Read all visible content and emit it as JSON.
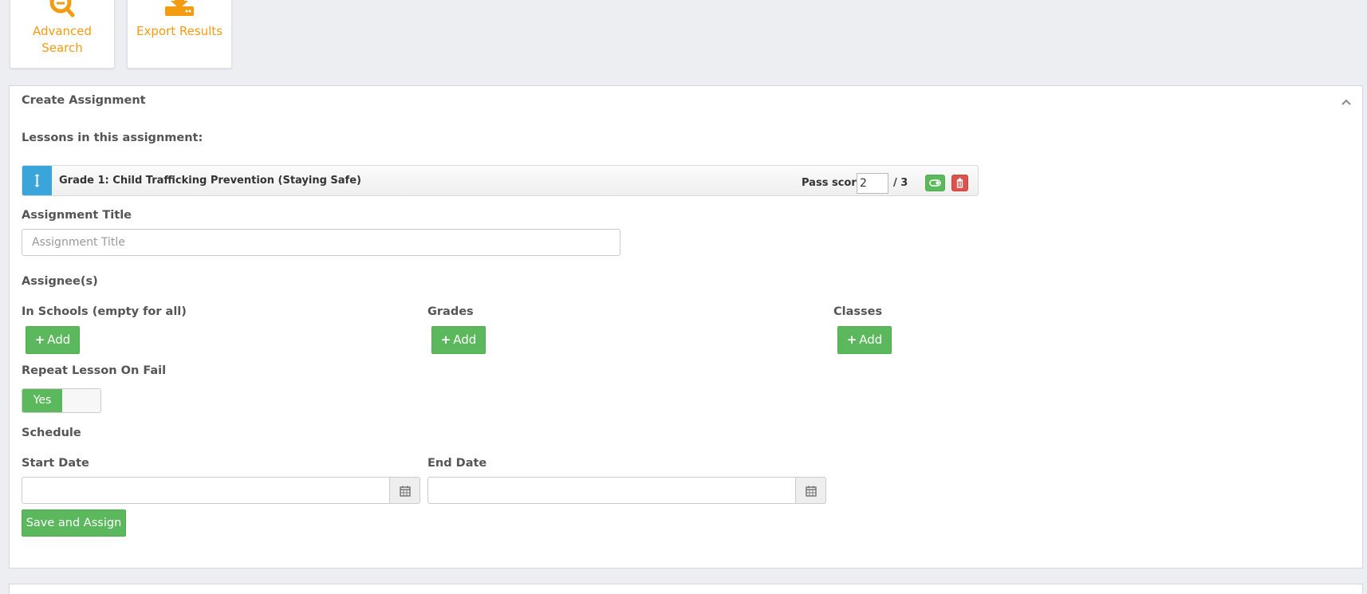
{
  "toolbar": {
    "advanced_search": "Advanced Search",
    "export_results": "Export Results"
  },
  "create_assignment": {
    "title": "Create Assignment",
    "lessons_label": "Lessons in this assignment:",
    "lessons": [
      {
        "name": "Grade 1: Child Trafficking Prevention (Staying Safe)",
        "pass_score_label": "Pass score",
        "pass_score": "2",
        "total": "/ 3"
      }
    ],
    "assignment_title_label": "Assignment Title",
    "assignment_title_placeholder": "Assignment Title",
    "assignment_title_value": "",
    "assignees_label": "Assignee(s)",
    "schools_label": "In Schools (empty for all)",
    "grades_label": "Grades",
    "classes_label": "Classes",
    "add_label": "Add",
    "repeat_label": "Repeat Lesson On Fail",
    "repeat_value": "Yes",
    "schedule_label": "Schedule",
    "start_date_label": "Start Date",
    "end_date_label": "End Date",
    "start_date_value": "",
    "end_date_value": "",
    "save_label": "Save and Assign"
  },
  "colors": {
    "accent_orange": "#f39c12",
    "success_green": "#5cb85c",
    "danger_red": "#d9534f",
    "drag_blue": "#3aa5db",
    "background": "#eceef2"
  },
  "icons": {
    "advanced_search": "search-icon",
    "export_results": "download-tray-icon",
    "collapse": "chevron-up-icon",
    "drag": "vertical-arrows-icon",
    "toggle": "toggle-on-icon",
    "delete": "trash-icon",
    "plus": "plus-icon",
    "calendar": "calendar-icon"
  }
}
